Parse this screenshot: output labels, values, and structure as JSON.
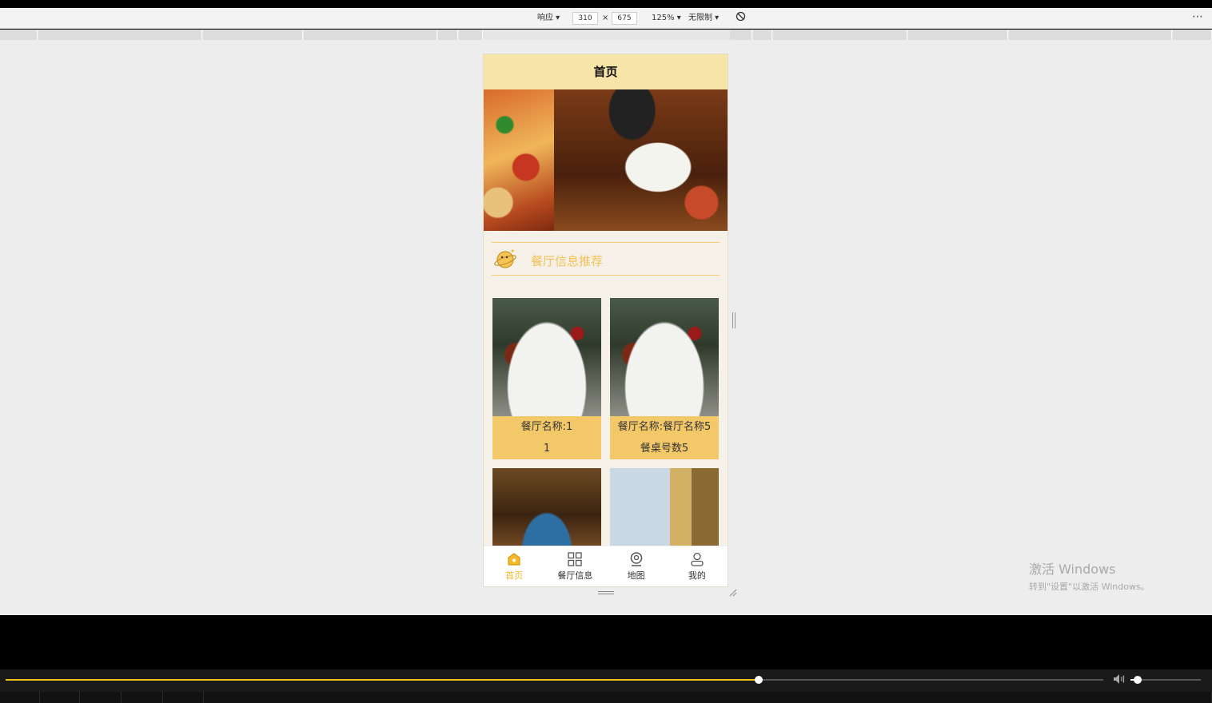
{
  "devtools": {
    "device": "响应 ▾",
    "width": "310",
    "times": "×",
    "height": "675",
    "zoom": "125% ▾",
    "throttle": "无限制 ▾",
    "rotate_icon": "rotate-icon",
    "more": "⋯"
  },
  "app": {
    "title": "首页",
    "section_title": "餐厅信息推荐",
    "cards": [
      {
        "name": "餐厅名称:1",
        "sub": "1"
      },
      {
        "name": "餐厅名称:餐厅名称5",
        "sub": "餐桌号数5"
      },
      {
        "name": "",
        "sub": ""
      },
      {
        "name": "",
        "sub": ""
      }
    ],
    "tabs": [
      {
        "label": "首页",
        "icon": "home-icon"
      },
      {
        "label": "餐厅信息",
        "icon": "grid-icon"
      },
      {
        "label": "地图",
        "icon": "map-pin-icon"
      },
      {
        "label": "我的",
        "icon": "user-icon"
      }
    ],
    "colors": {
      "accent": "#f1b929",
      "header": "#f7e4a9",
      "card": "#f3c868"
    }
  },
  "watermark": {
    "title": "激活 Windows",
    "subtitle": "转到\"设置\"以激活 Windows。"
  },
  "player": {
    "progress": 0.686,
    "volume": 0.1
  }
}
